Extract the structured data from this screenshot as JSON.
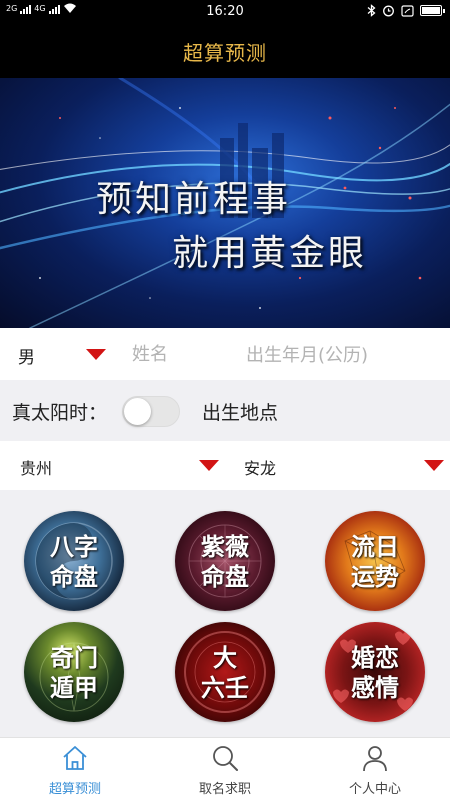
{
  "status_bar": {
    "network_left": "2G",
    "network_right": "4G",
    "time": "16:20"
  },
  "header": {
    "title": "超算预测"
  },
  "banner": {
    "line1": "预知前程事",
    "line2": "就用黄金眼"
  },
  "form": {
    "gender": "男",
    "name_placeholder": "姓名",
    "birth_placeholder": "出生年月(公历)",
    "true_solar_time_label": "真太阳时：",
    "true_solar_time_on": false,
    "birthplace_label": "出生地点",
    "province": "贵州",
    "city": "安龙",
    "dropdown_color": "#d21414"
  },
  "features": [
    {
      "line1": "八字",
      "line2": "命盘"
    },
    {
      "line1": "紫薇",
      "line2": "命盘"
    },
    {
      "line1": "流日",
      "line2": "运势"
    },
    {
      "line1": "奇门",
      "line2": "遁甲"
    },
    {
      "line1": "大",
      "line2": "六壬"
    },
    {
      "line1": "婚恋",
      "line2": "感情"
    }
  ],
  "tabbar": {
    "items": [
      {
        "label": "超算预测",
        "icon": "home-icon",
        "active": true
      },
      {
        "label": "取名求职",
        "icon": "search-icon",
        "active": false
      },
      {
        "label": "个人中心",
        "icon": "person-icon",
        "active": false
      }
    ],
    "active_color": "#3a8fd6"
  },
  "colors": {
    "title": "#e8b84a",
    "header_bg": "#000000"
  }
}
